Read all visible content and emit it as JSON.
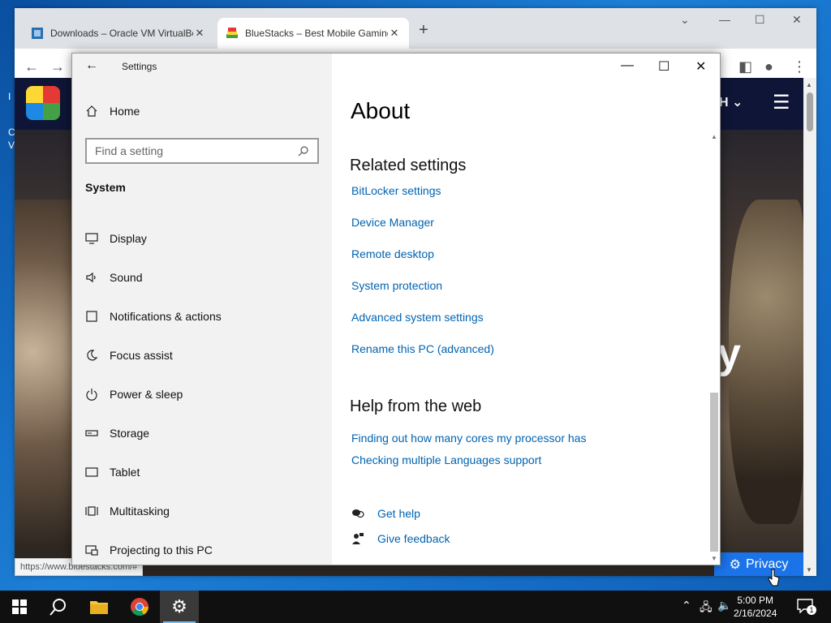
{
  "desktop": {
    "icon_text": [
      "I",
      "C",
      "V"
    ]
  },
  "browser": {
    "tabs": [
      {
        "title": "Downloads – Oracle VM VirtualBox"
      },
      {
        "title": "BlueStacks – Best Mobile Gaming Platform"
      }
    ],
    "new_tab": "+",
    "status_url": "https://www.bluestacks.com/#",
    "page": {
      "header_lang": "H",
      "big_letter": "y",
      "privacy_label": "Privacy"
    }
  },
  "settings": {
    "title": "Settings",
    "home": "Home",
    "search_placeholder": "Find a setting",
    "section": "System",
    "nav": [
      {
        "label": "Display",
        "icon": "display-icon"
      },
      {
        "label": "Sound",
        "icon": "sound-icon"
      },
      {
        "label": "Notifications & actions",
        "icon": "notifications-icon"
      },
      {
        "label": "Focus assist",
        "icon": "moon-icon"
      },
      {
        "label": "Power & sleep",
        "icon": "power-icon"
      },
      {
        "label": "Storage",
        "icon": "storage-icon"
      },
      {
        "label": "Tablet",
        "icon": "tablet-icon"
      },
      {
        "label": "Multitasking",
        "icon": "multitasking-icon"
      },
      {
        "label": "Projecting to this PC",
        "icon": "projecting-icon"
      }
    ],
    "page_title": "About",
    "related_heading": "Related settings",
    "related_links": [
      "BitLocker settings",
      "Device Manager",
      "Remote desktop",
      "System protection",
      "Advanced system settings",
      "Rename this PC (advanced)"
    ],
    "web_heading": "Help from the web",
    "web_links": [
      "Finding out how many cores my processor has",
      "Checking multiple Languages support"
    ],
    "get_help": "Get help",
    "give_feedback": "Give feedback"
  },
  "taskbar": {
    "time": "5:00 PM",
    "date": "2/16/2024",
    "notification_count": "1"
  },
  "colors": {
    "link": "#0063b1",
    "accent": "#1a73e8",
    "taskbar": "#101010"
  }
}
